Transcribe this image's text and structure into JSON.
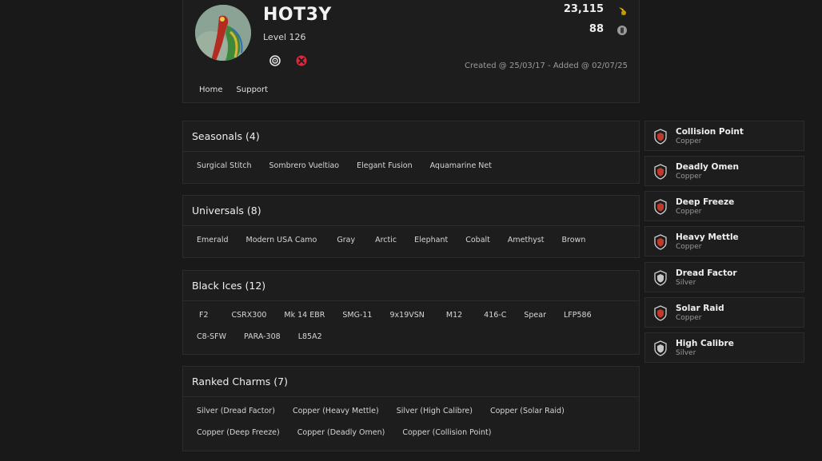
{
  "profile": {
    "username": "HOT3Y",
    "level": "Level 126",
    "stat1_value": "23,115",
    "stat2_value": "88",
    "created": "Created @ 25/03/17 - Added @ 02/07/25",
    "platforms": [
      "ubisoft-icon",
      "xbox-icon"
    ],
    "nav": [
      "Home",
      "Support"
    ]
  },
  "sections": {
    "seasonals": {
      "title": "Seasonals (4)",
      "items": [
        "Surgical Stitch",
        "Sombrero Vueltiao",
        "Elegant Fusion",
        "Aquamarine Net"
      ]
    },
    "universals": {
      "title": "Universals (8)",
      "items": [
        "Emerald",
        "Modern USA Camo",
        "Gray",
        "Arctic",
        "Elephant",
        "Cobalt",
        "Amethyst",
        "Brown"
      ]
    },
    "black_ices": {
      "title": "Black Ices (12)",
      "items": [
        "F2",
        "CSRX300",
        "Mk 14 EBR",
        "SMG-11",
        "9x19VSN",
        "M12",
        "416-C",
        "Spear",
        "LFP586",
        "C8-SFW",
        "PARA-308",
        "L85A2"
      ]
    },
    "ranked_charms": {
      "title": "Ranked Charms (7)",
      "items": [
        "Silver (Dread Factor)",
        "Copper (Heavy Mettle)",
        "Silver (High Calibre)",
        "Copper (Solar Raid)",
        "Copper (Deep Freeze)",
        "Copper (Deadly Omen)",
        "Copper (Collision Point)"
      ]
    }
  },
  "charms": [
    {
      "name": "Collision Point",
      "rank": "Copper"
    },
    {
      "name": "Deadly Omen",
      "rank": "Copper"
    },
    {
      "name": "Deep Freeze",
      "rank": "Copper"
    },
    {
      "name": "Heavy Mettle",
      "rank": "Copper"
    },
    {
      "name": "Dread Factor",
      "rank": "Silver"
    },
    {
      "name": "Solar Raid",
      "rank": "Copper"
    },
    {
      "name": "High Calibre",
      "rank": "Silver"
    }
  ],
  "colors": {
    "background": "#191919",
    "panel": "#1d1d1d",
    "copper_badge": "#c0392b",
    "silver_badge": "#c8c8c8",
    "xbox_red": "#e0263a",
    "coin_gold": "#e3b400"
  },
  "icons": {
    "stat1": "coin-icon",
    "stat2": "renown-icon",
    "charm_badge": "rank-shield-icon"
  }
}
